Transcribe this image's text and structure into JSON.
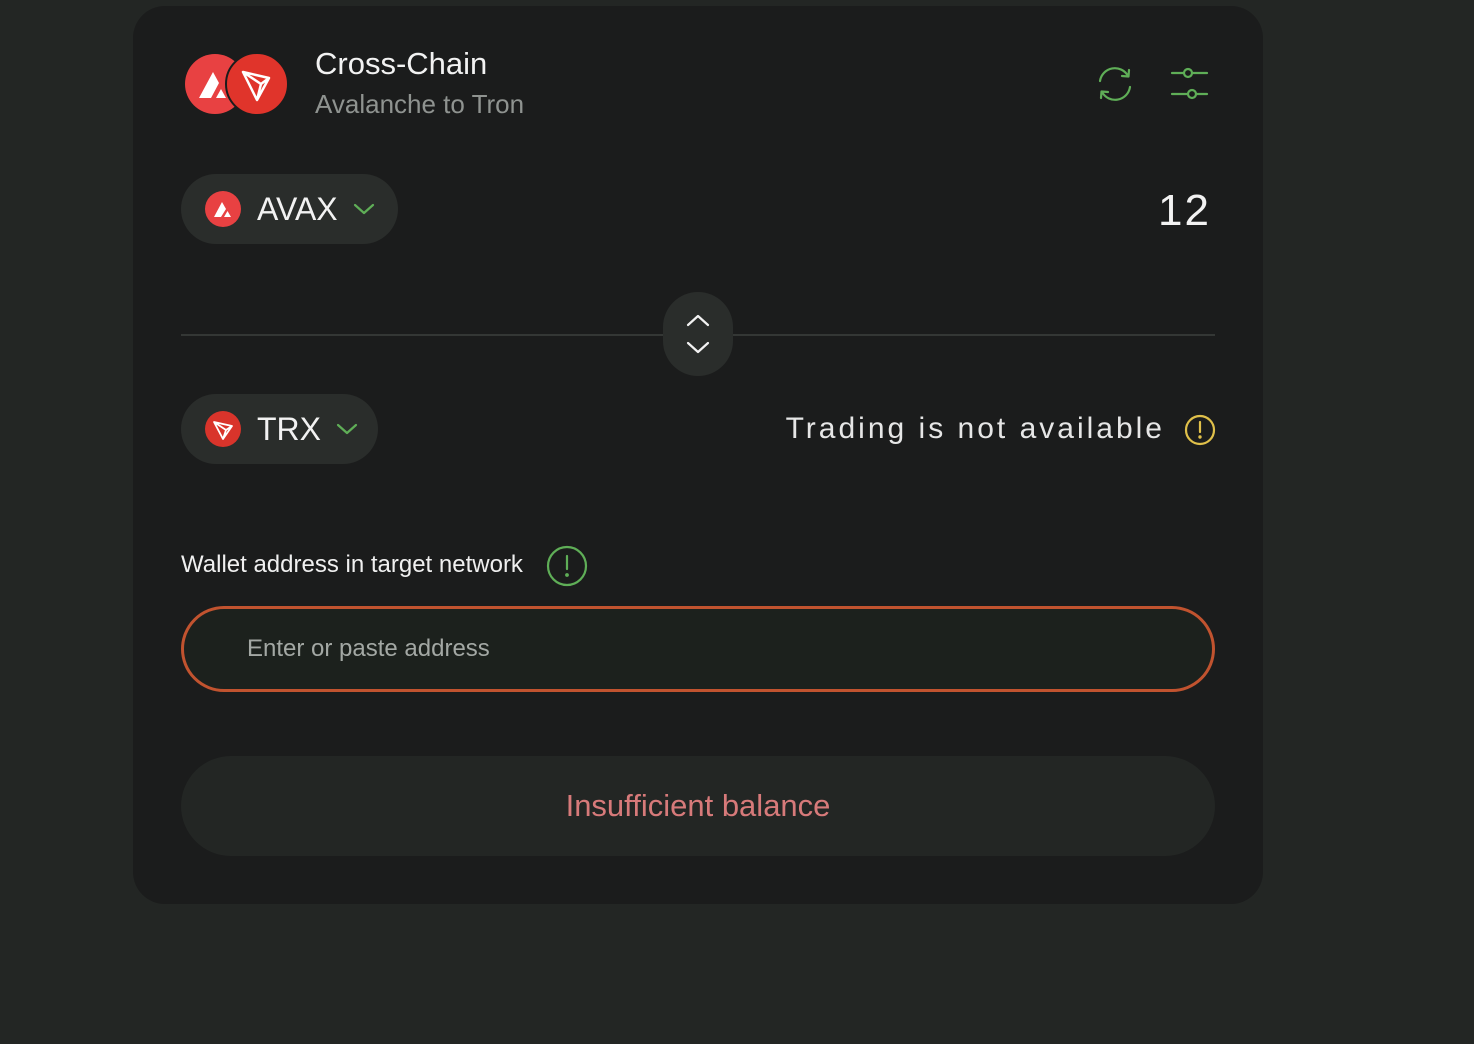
{
  "header": {
    "title": "Cross-Chain",
    "subtitle": "Avalanche to Tron",
    "icons": [
      "avalanche-logo",
      "tron-logo",
      "refresh-icon",
      "settings-sliders-icon"
    ]
  },
  "from": {
    "symbol": "AVAX",
    "amount": "12",
    "icon": "avalanche-logo"
  },
  "to": {
    "symbol": "TRX",
    "status": "Trading is not available",
    "icon": "tron-logo"
  },
  "wallet": {
    "label": "Wallet address in target network",
    "placeholder": "Enter or paste address",
    "value": ""
  },
  "submit": {
    "label": "Insufficient balance"
  },
  "colors": {
    "page_bg": "#232624",
    "card_bg": "#1b1c1c",
    "accent_green": "#5fae57",
    "warning_yellow": "#e0c04a",
    "error_border": "#c1532f",
    "error_text": "#d77a7a",
    "avalanche_red": "#e84142",
    "tron_red": "#d9342b"
  }
}
